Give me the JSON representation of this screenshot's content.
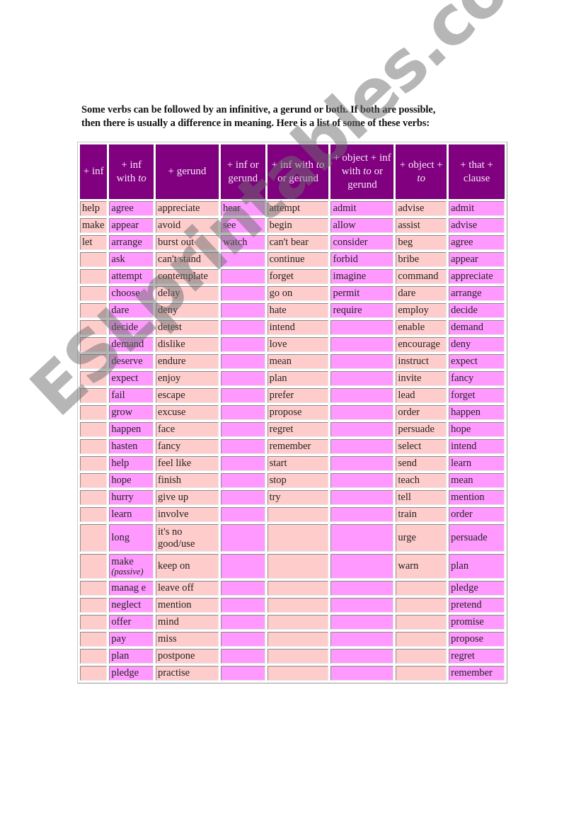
{
  "intro": {
    "line1": "Some verbs can be followed by an infinitive, a gerund or both.  If both are possible,",
    "line2": "then there is usually a difference in meaning.  Here is a list of some of these verbs:"
  },
  "table": {
    "headers": [
      {
        "pre": "+ inf",
        "italic": "",
        "post": ""
      },
      {
        "pre": "+ inf with ",
        "italic": "to",
        "post": ""
      },
      {
        "pre": "+ gerund",
        "italic": "",
        "post": ""
      },
      {
        "pre": "+ inf or gerund",
        "italic": "",
        "post": ""
      },
      {
        "pre": "+ inf with ",
        "italic": "to",
        "post": " or gerund"
      },
      {
        "pre": "+ object + inf with ",
        "italic": "to",
        "post": " or gerund"
      },
      {
        "pre": "+ object + ",
        "italic": "to",
        "post": ""
      },
      {
        "pre": "+ that + clause",
        "italic": "",
        "post": ""
      }
    ],
    "column_colors": [
      "#ffcccc",
      "#ff99ff",
      "#ffcccc",
      "#ff99ff",
      "#ffcccc",
      "#ff99ff",
      "#ffcccc",
      "#ff99ff"
    ],
    "header_color": "#800080",
    "rows": [
      [
        "help",
        "agree",
        "appreciate",
        "hear",
        "attempt",
        "admit",
        "advise",
        "admit"
      ],
      [
        "make",
        "appear",
        "avoid",
        "see",
        "begin",
        "allow",
        "assist",
        "advise"
      ],
      [
        "let",
        "arrange",
        "burst out",
        "watch",
        "can't bear",
        "consider",
        "beg",
        "agree"
      ],
      [
        "",
        "ask",
        "can't stand",
        "",
        "continue",
        "forbid",
        "bribe",
        "appear"
      ],
      [
        "",
        "attempt",
        "contemplate",
        "",
        "forget",
        "imagine",
        "command",
        "appreciate"
      ],
      [
        "",
        "choose",
        "delay",
        "",
        "go on",
        "permit",
        "dare",
        "arrange"
      ],
      [
        "",
        "dare",
        "deny",
        "",
        "hate",
        "require",
        "employ",
        "decide"
      ],
      [
        "",
        "decide",
        "detest",
        "",
        "intend",
        "",
        "enable",
        "demand"
      ],
      [
        "",
        "demand",
        "dislike",
        "",
        "love",
        "",
        "encourage",
        "deny"
      ],
      [
        "",
        "deserve",
        "endure",
        "",
        "mean",
        "",
        "instruct",
        "expect"
      ],
      [
        "",
        "expect",
        "enjoy",
        "",
        "plan",
        "",
        "invite",
        "fancy"
      ],
      [
        "",
        "fail",
        "escape",
        "",
        "prefer",
        "",
        "lead",
        "forget"
      ],
      [
        "",
        "grow",
        "excuse",
        "",
        "propose",
        "",
        "order",
        "happen"
      ],
      [
        "",
        "happen",
        "face",
        "",
        "regret",
        "",
        "persuade",
        "hope"
      ],
      [
        "",
        "hasten",
        "fancy",
        "",
        "remember",
        "",
        "select",
        "intend"
      ],
      [
        "",
        "help",
        "feel like",
        "",
        "start",
        "",
        "send",
        "learn"
      ],
      [
        "",
        "hope",
        "finish",
        "",
        "stop",
        "",
        "teach",
        "mean"
      ],
      [
        "",
        "hurry",
        "give up",
        "",
        "try",
        "",
        "tell",
        "mention"
      ],
      [
        "",
        "learn",
        "involve",
        "",
        "",
        "",
        "train",
        "order"
      ],
      [
        "",
        "long",
        "it's no good/use",
        "",
        "",
        "",
        "urge",
        "persuade"
      ],
      [
        "",
        "make",
        "keep on",
        "",
        "",
        "",
        "warn",
        "plan"
      ],
      [
        "",
        "manag e",
        "leave off",
        "",
        "",
        "",
        "",
        "pledge"
      ],
      [
        "",
        "neglect",
        "mention",
        "",
        "",
        "",
        "",
        "pretend"
      ],
      [
        "",
        "offer",
        "mind",
        "",
        "",
        "",
        "",
        "promise"
      ],
      [
        "",
        "pay",
        "miss",
        "",
        "",
        "",
        "",
        "propose"
      ],
      [
        "",
        "plan",
        "postpone",
        "",
        "",
        "",
        "",
        "regret"
      ],
      [
        "",
        "pledge",
        "practise",
        "",
        "",
        "",
        "",
        "remember"
      ]
    ],
    "notes": {
      "make_passive": "(passive)"
    }
  },
  "watermark": {
    "text": "ESLprintables.com"
  }
}
